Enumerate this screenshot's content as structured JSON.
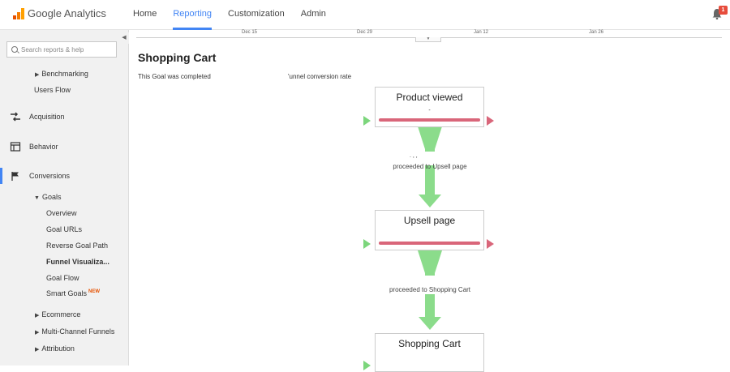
{
  "app": {
    "title": "Google Analytics",
    "nav": [
      "Home",
      "Reporting",
      "Customization",
      "Admin"
    ],
    "active_nav": "Reporting",
    "notification_count": "1"
  },
  "sidebar": {
    "search_placeholder": "Search reports & help",
    "items": [
      {
        "label": "Benchmarking",
        "level": 1
      },
      {
        "label": "Users Flow",
        "level": 1
      },
      {
        "label": "Acquisition",
        "level": 0
      },
      {
        "label": "Behavior",
        "level": 0
      },
      {
        "label": "Conversions",
        "level": 0
      },
      {
        "label": "Goals",
        "level": 1
      },
      {
        "label": "Overview",
        "level": 2
      },
      {
        "label": "Goal URLs",
        "level": 2
      },
      {
        "label": "Reverse Goal Path",
        "level": 2
      },
      {
        "label": "Funnel Visualiza...",
        "level": 2
      },
      {
        "label": "Goal Flow",
        "level": 2
      },
      {
        "label": "Smart Goals",
        "level": 2
      },
      {
        "label": "Ecommerce",
        "level": 1
      },
      {
        "label": "Multi-Channel Funnels",
        "level": 1
      },
      {
        "label": "Attribution",
        "level": 1
      }
    ],
    "new_badge": "NEW"
  },
  "main": {
    "timeline_labels": [
      "Dec 15",
      "Dec 29",
      "Jan 12",
      "Jan 26"
    ],
    "title": "Shopping Cart",
    "goal_text": "This Goal was completed",
    "conversion_text": "'unnel conversion rate",
    "funnel": {
      "stages": [
        {
          "title": "Product viewed",
          "sub": "-"
        },
        {
          "title": "Upsell page",
          "sub": ""
        },
        {
          "title": "Shopping Cart",
          "sub": ""
        }
      ],
      "proceed_labels": [
        "proceeded to Upsell page",
        "proceeded to Shopping Cart"
      ],
      "partial_value": ". , ,"
    }
  },
  "colors": {
    "accent": "#4285f4",
    "entry_arrow": "#7cd67c",
    "exit_arrow": "#d9667a",
    "flow": "#8bdc8b"
  }
}
